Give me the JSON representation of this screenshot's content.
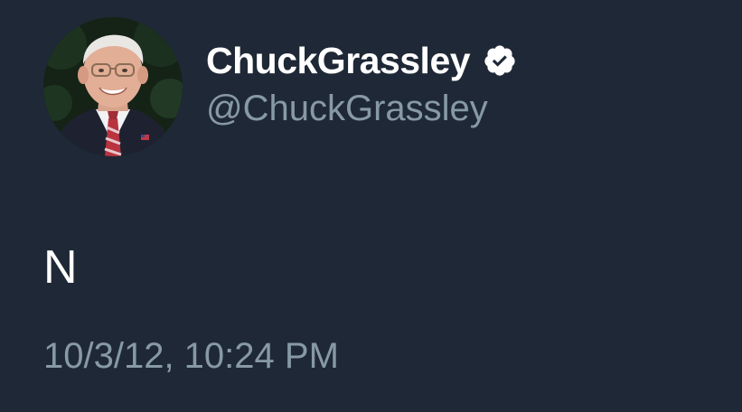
{
  "tweet": {
    "display_name": "ChuckGrassley",
    "handle": "@ChuckGrassley",
    "text": "N",
    "timestamp": "10/3/12, 10:24 PM",
    "verified_icon": "verified-badge-icon",
    "avatar_icon": "profile-photo"
  },
  "colors": {
    "background": "#1f2836",
    "name": "#ffffff",
    "secondary_text": "#8899a6",
    "tweet_text": "#ffffff"
  }
}
